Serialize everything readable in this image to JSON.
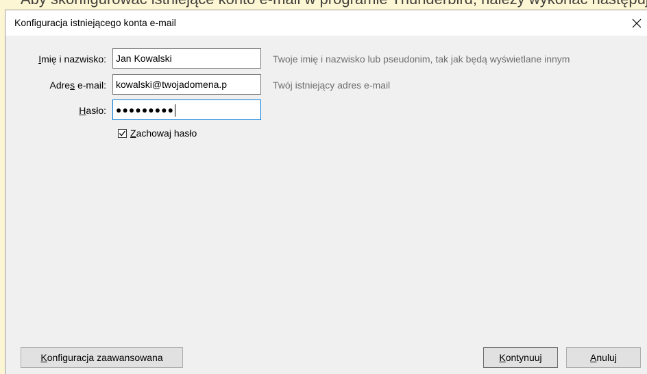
{
  "background": {
    "partial_text": "Aby skonfigurować istniejące konto e-mail w programie Thunderbird, należy wykonać następujące kroki:"
  },
  "dialog": {
    "title": "Konfiguracja istniejącego konta e-mail",
    "close_icon": "close-icon"
  },
  "form": {
    "name_label_pre": "",
    "name_label_u": "I",
    "name_label_post": "mię i nazwisko:",
    "name_value": "Jan Kowalski",
    "name_hint": "Twoje imię i nazwisko lub pseudonim, tak jak będą wyświetlane innym",
    "email_label_pre": "Adre",
    "email_label_u": "s",
    "email_label_post": " e-mail:",
    "email_value": "kowalski@twojadomena.p",
    "email_hint": "Twój istniejący adres e-mail",
    "password_label_pre": "",
    "password_label_u": "H",
    "password_label_post": "asło:",
    "password_masked": "●●●●●●●●●",
    "remember_label_u": "Z",
    "remember_label_post": "achowaj hasło",
    "remember_checked": true
  },
  "buttons": {
    "advanced_u": "K",
    "advanced_post": "onfiguracja zaawansowana",
    "continue_u": "K",
    "continue_post": "ontynuuj",
    "cancel_u": "A",
    "cancel_post": "nuluj"
  },
  "colors": {
    "dialog_bg": "#f0f0f0",
    "focus_border": "#0078d7",
    "hint_text": "#6d6d6d"
  }
}
